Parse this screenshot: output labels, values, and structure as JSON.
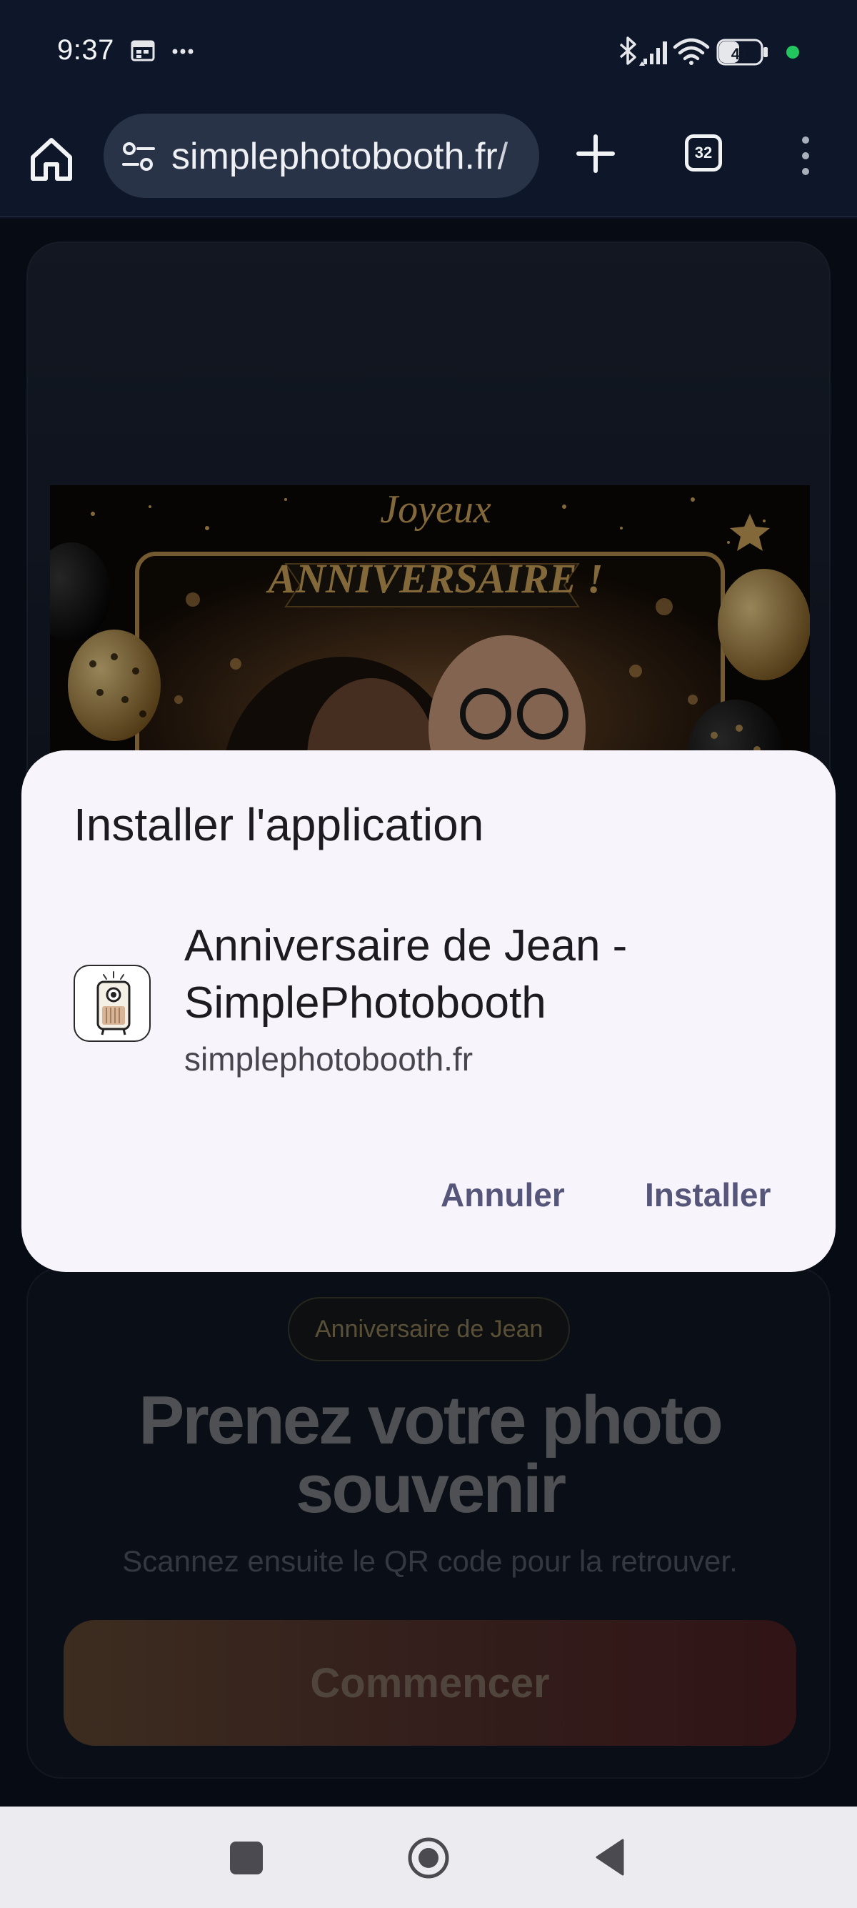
{
  "status_bar": {
    "time": "9:37",
    "battery_level": "41",
    "icons": [
      "calendar-icon",
      "more-dots-icon",
      "bluetooth-icon",
      "cellular-icon",
      "wifi-icon",
      "battery-icon",
      "dot-indicator-icon"
    ]
  },
  "browser": {
    "url": "simplephotobooth.fr/",
    "tab_count": "32"
  },
  "page": {
    "photo_banner_line1": "Joyeux",
    "photo_banner_line2": "ANNIVERSAIRE !",
    "event_badge": "Anniversaire de Jean",
    "hero_title_line1": "Prenez votre photo",
    "hero_title_line2": "souvenir",
    "hero_subtitle": "Scannez ensuite le QR code pour la retrouver.",
    "start_button": "Commencer"
  },
  "dialog": {
    "title": "Installer l'application",
    "app_name_line1": "Anniversaire de Jean -",
    "app_name_line2": "SimplePhotobooth",
    "app_domain": "simplephotobooth.fr",
    "cancel_label": "Annuler",
    "install_label": "Installer"
  },
  "colors": {
    "dialog_bg": "#f7f4fb",
    "action_text": "#55567a",
    "browser_bg": "#0e172a",
    "accent_gold": "#c9a15a"
  }
}
